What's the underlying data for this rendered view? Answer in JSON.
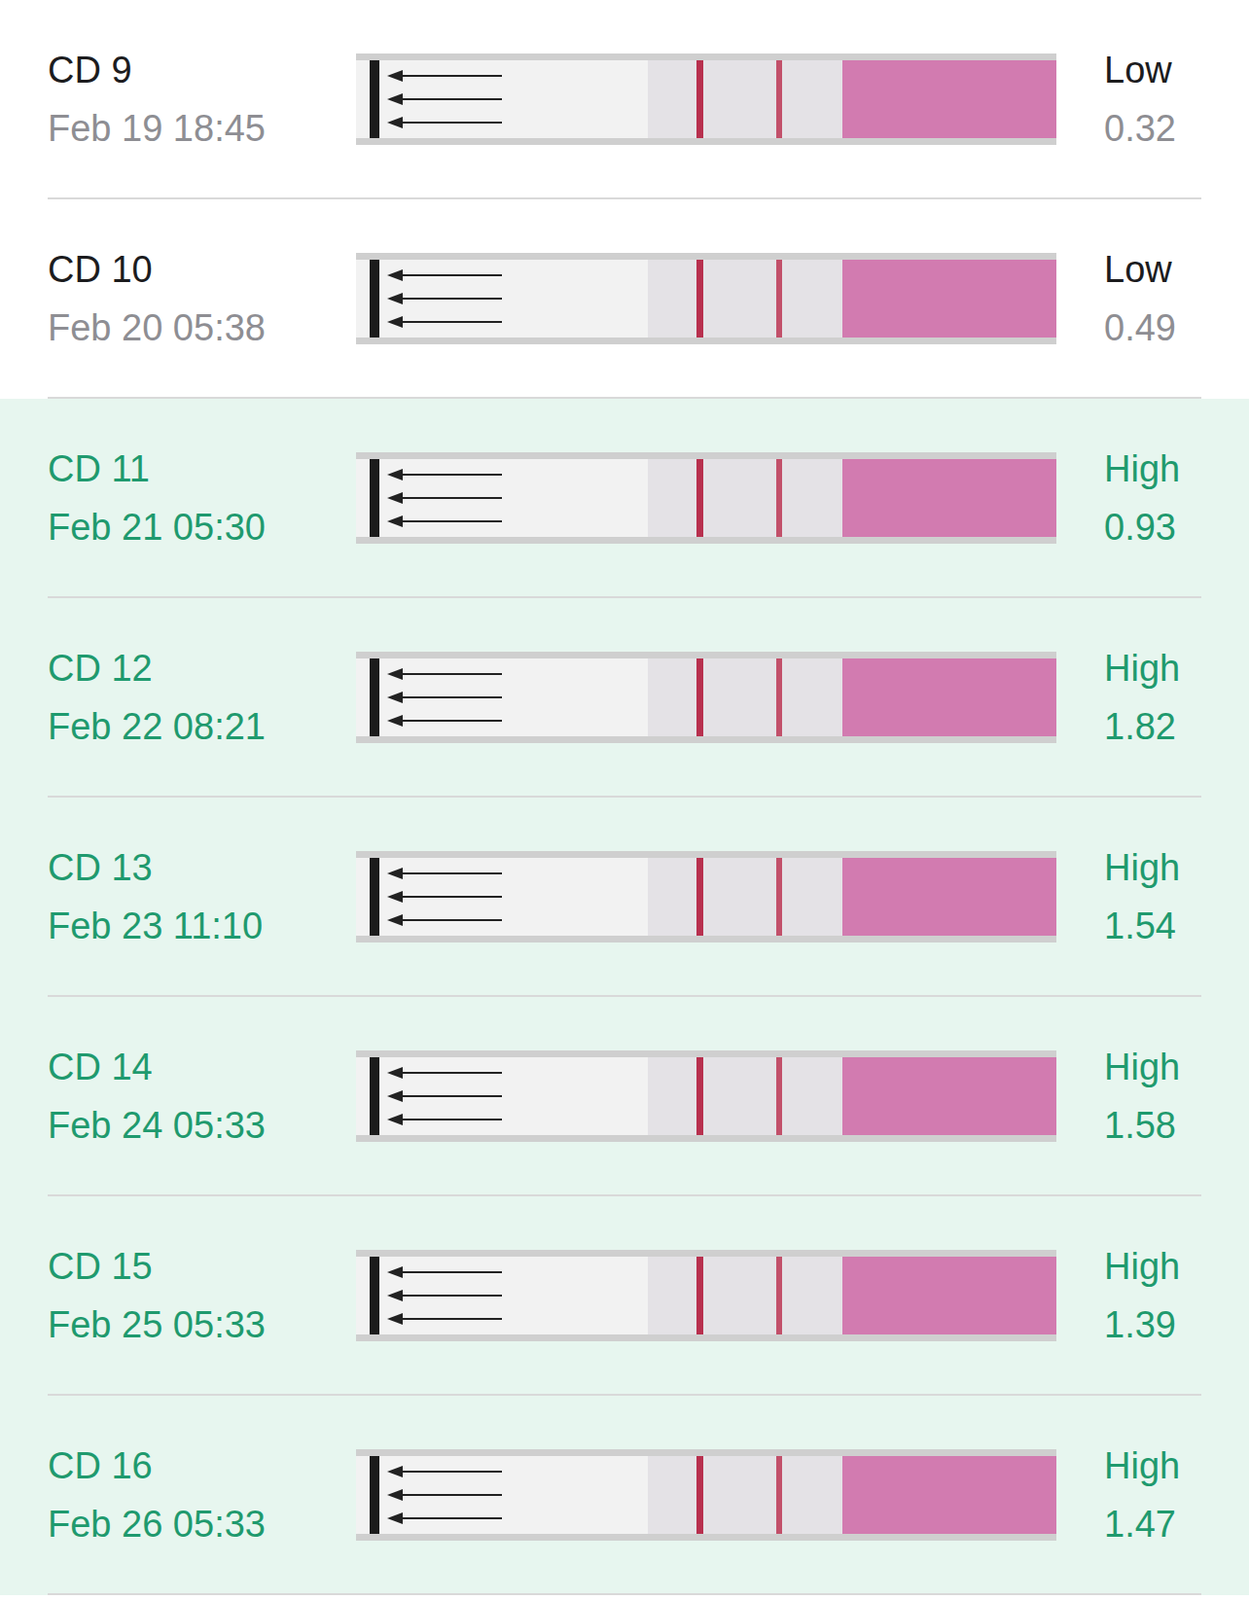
{
  "tests": [
    {
      "day": "CD 9",
      "date": "Feb 19 18:45",
      "result": "Low",
      "value": "0.32",
      "highlighted": false
    },
    {
      "day": "CD 10",
      "date": "Feb 20 05:38",
      "result": "Low",
      "value": "0.49",
      "highlighted": false
    },
    {
      "day": "CD 11",
      "date": "Feb 21 05:30",
      "result": "High",
      "value": "0.93",
      "highlighted": true
    },
    {
      "day": "CD 12",
      "date": "Feb 22 08:21",
      "result": "High",
      "value": "1.82",
      "highlighted": true
    },
    {
      "day": "CD 13",
      "date": "Feb 23 11:10",
      "result": "High",
      "value": "1.54",
      "highlighted": true
    },
    {
      "day": "CD 14",
      "date": "Feb 24 05:33",
      "result": "High",
      "value": "1.58",
      "highlighted": true
    },
    {
      "day": "CD 15",
      "date": "Feb 25 05:33",
      "result": "High",
      "value": "1.39",
      "highlighted": true
    },
    {
      "day": "CD 16",
      "date": "Feb 26 05:33",
      "result": "High",
      "value": "1.47",
      "highlighted": true
    }
  ]
}
